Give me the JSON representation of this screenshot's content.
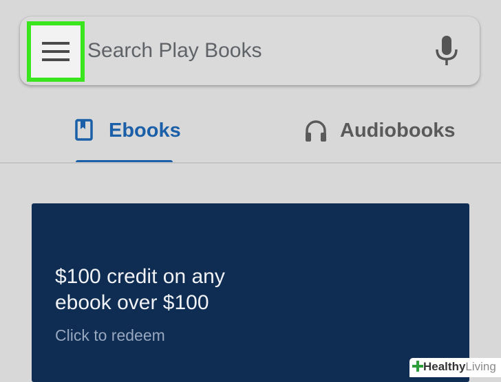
{
  "search": {
    "placeholder": "Search Play Books",
    "menu_icon": "hamburger-menu-icon",
    "mic_icon": "microphone-icon"
  },
  "tabs": [
    {
      "label": "Ebooks",
      "icon": "book-icon",
      "selected": true
    },
    {
      "label": "Audiobooks",
      "icon": "headphones-icon",
      "selected": false
    }
  ],
  "promo": {
    "title": "$100 credit on any ebook over $100",
    "subtitle": "Click to redeem"
  },
  "watermark": {
    "brand_bold": "Healthy",
    "brand_light": "Living"
  },
  "colors": {
    "background": "#d8d8d8",
    "accent_blue": "#1a5fa7",
    "highlight_green": "#39e61e",
    "promo_background": "#0f2d52",
    "brand_green": "#2e9e3b"
  }
}
